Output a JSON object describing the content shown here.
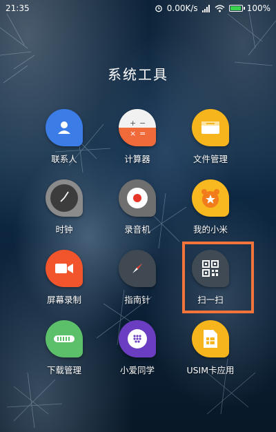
{
  "status_bar": {
    "time": "21:35",
    "network_speed": "0.00K/s",
    "battery_percent": "100%",
    "icons": [
      "alarm-icon",
      "signal-icon",
      "wifi-icon",
      "battery-icon"
    ]
  },
  "folder": {
    "title": "系统工具"
  },
  "apps": [
    {
      "label": "联系人",
      "icon": "contacts-icon",
      "color": "#3b7ce6"
    },
    {
      "label": "计算器",
      "icon": "calculator-icon",
      "color": "#f06a3a"
    },
    {
      "label": "文件管理",
      "icon": "file-manager-icon",
      "color": "#f6b51c"
    },
    {
      "label": "时钟",
      "icon": "clock-icon",
      "color": "#4a4a4a"
    },
    {
      "label": "录音机",
      "icon": "recorder-icon",
      "color": "#6f6f6f"
    },
    {
      "label": "我的小米",
      "icon": "my-xiaomi-icon",
      "color": "#f8b820"
    },
    {
      "label": "屏幕录制",
      "icon": "screen-record-icon",
      "color": "#f2552c"
    },
    {
      "label": "指南针",
      "icon": "compass-icon",
      "color": "#404952"
    },
    {
      "label": "扫一扫",
      "icon": "scanner-icon",
      "color": "#3f4a54"
    },
    {
      "label": "下载管理",
      "icon": "download-manager-icon",
      "color": "#5cbf6a"
    },
    {
      "label": "小爱同学",
      "icon": "xiaoai-icon",
      "color": "#6b3dc0"
    },
    {
      "label": "USIM卡应用",
      "icon": "sim-card-icon",
      "color": "#f6b51c"
    }
  ],
  "highlight": {
    "target": "扫一扫",
    "color": "#f2743a"
  }
}
